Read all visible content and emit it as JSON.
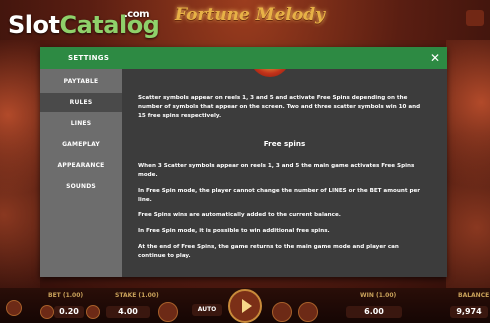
{
  "watermark": {
    "part1": "Slot",
    "part2": "Catalog",
    "suffix": ".com"
  },
  "game": {
    "title": "Fortune Melody"
  },
  "modal": {
    "title": "SETTINGS",
    "close": "✕",
    "nav": [
      {
        "label": "PAYTABLE",
        "active": false
      },
      {
        "label": "RULES",
        "active": true
      },
      {
        "label": "LINES",
        "active": false
      },
      {
        "label": "GAMEPLAY",
        "active": false
      },
      {
        "label": "APPEARANCE",
        "active": false
      },
      {
        "label": "SOUNDS",
        "active": false
      }
    ],
    "content": {
      "intro": "Scatter symbols appear on reels 1, 3 and 5 and activate Free Spins depending on the number of symbols that appear on the screen. Two and three scatter symbols win 10 and 15 free spins respectively.",
      "section_title": "Free spins",
      "paragraphs": [
        "When 3 Scatter symbols appear on reels 1, 3 and 5 the main game activates Free Spins mode.",
        "In Free Spin mode, the player cannot change the number of LINES or the BET amount per line.",
        "Free Spins wins are automatically added to the current balance.",
        "In Free Spin mode, it is possible to win additional free spins.",
        "At the end of Free Spins, the game returns to the main game mode and player can continue to play."
      ]
    }
  },
  "bottom_bar": {
    "bet_label": "BET (1.00)",
    "bet_value": "0.20",
    "stake_label": "STAKE (1.00)",
    "stake_value": "4.00",
    "auto_label": "AUTO",
    "win_label": "WIN (1.00)",
    "win_value": "6.00",
    "balance_label": "BALANCE",
    "balance_value": "9,974"
  }
}
